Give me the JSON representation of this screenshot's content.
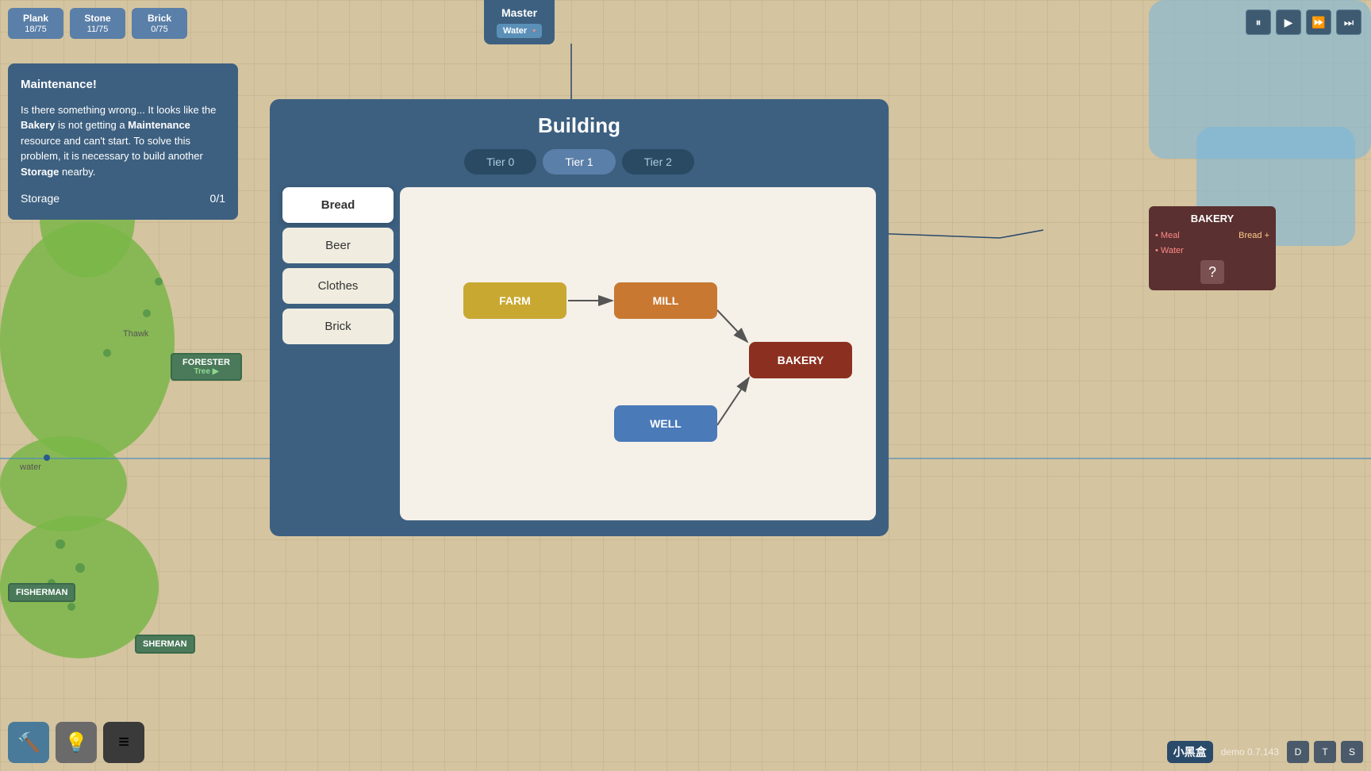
{
  "map": {
    "background_color": "#d4c4a0"
  },
  "resources": [
    {
      "name": "Plank",
      "value": "18/75"
    },
    {
      "name": "Stone",
      "value": "11/75"
    },
    {
      "name": "Brick",
      "value": "0/75"
    }
  ],
  "maintenance": {
    "title": "Maintenance!",
    "description_start": "Is there something wrong... It looks like the ",
    "bakery_bold": "Bakery",
    "description_mid": " is not getting a ",
    "maintenance_bold": "Maintenance",
    "description_end": " resource and can't start. To solve this problem, it is necessary to build another ",
    "storage_bold": "Storage",
    "description_final": " nearby.",
    "storage_label": "Storage",
    "storage_value": "0/1"
  },
  "master": {
    "title": "Master",
    "water_label": "Water"
  },
  "building_dialog": {
    "title": "Building",
    "tabs": [
      {
        "label": "Tier 0",
        "active": false
      },
      {
        "label": "Tier 1",
        "active": true
      },
      {
        "label": "Tier 2",
        "active": false
      }
    ],
    "sidebar_items": [
      {
        "label": "Bread",
        "active": true
      },
      {
        "label": "Beer",
        "active": false
      },
      {
        "label": "Clothes",
        "active": false
      },
      {
        "label": "Brick",
        "active": false
      }
    ],
    "flow": {
      "nodes": [
        {
          "id": "farm",
          "label": "FARM",
          "color": "#c8a830"
        },
        {
          "id": "mill",
          "label": "MILL",
          "color": "#c87830"
        },
        {
          "id": "bakery",
          "label": "BAKERY",
          "color": "#8b3020"
        },
        {
          "id": "well",
          "label": "WELL",
          "color": "#4a7ab8"
        }
      ]
    }
  },
  "bakery_panel": {
    "title": "BAKERY",
    "rows": [
      {
        "label": "Meal",
        "value": "Bread +"
      },
      {
        "label": "Water",
        "value": ""
      }
    ]
  },
  "map_buildings": [
    {
      "id": "forester",
      "label": "FORESTER",
      "sub": "Tree"
    },
    {
      "id": "fisherman",
      "label": "FISHERMAN"
    },
    {
      "id": "sherman",
      "label": "SHERMAN"
    }
  ],
  "controls": {
    "pause": "⏸",
    "play": "▶",
    "fast": "⏩",
    "fastest": "⏭"
  },
  "toolbar": [
    {
      "id": "hammer",
      "icon": "🔨"
    },
    {
      "id": "lightbulb",
      "icon": "💡"
    },
    {
      "id": "menu",
      "icon": "≡"
    }
  ],
  "version": {
    "text": "demo 0.7.143",
    "logo": "小黑盒"
  },
  "map_labels": [
    {
      "id": "thawk",
      "text": "Thawk"
    },
    {
      "id": "water_dot",
      "text": "water"
    }
  ]
}
